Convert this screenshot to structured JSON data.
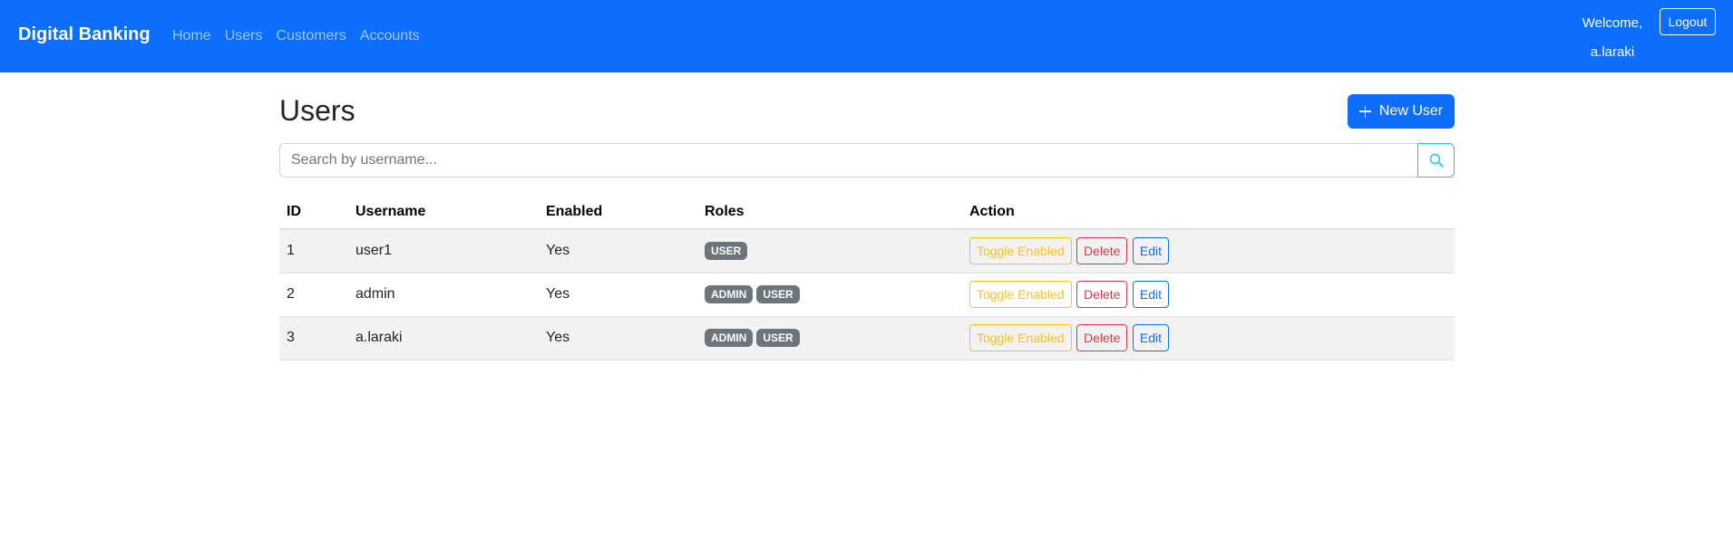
{
  "navbar": {
    "brand": "Digital Banking",
    "links": [
      "Home",
      "Users",
      "Customers",
      "Accounts"
    ],
    "welcome_line1": "Welcome,",
    "welcome_line2": "a.laraki",
    "logout_label": "Logout",
    "background_color": "#0d6efd"
  },
  "page": {
    "title": "Users",
    "new_user_label": "New User",
    "new_user_icon": "plus-icon"
  },
  "search": {
    "placeholder": "Search by username...",
    "value": "",
    "icon": "search-icon"
  },
  "table": {
    "headers": [
      "ID",
      "Username",
      "Enabled",
      "Roles",
      "Action"
    ],
    "rows": [
      {
        "id": "1",
        "username": "user1",
        "enabled": "Yes",
        "roles": [
          "USER"
        ]
      },
      {
        "id": "2",
        "username": "admin",
        "enabled": "Yes",
        "roles": [
          "ADMIN",
          "USER"
        ]
      },
      {
        "id": "3",
        "username": "a.laraki",
        "enabled": "Yes",
        "roles": [
          "ADMIN",
          "USER"
        ]
      }
    ],
    "actions": {
      "toggle_label": "Toggle Enabled",
      "delete_label": "Delete",
      "edit_label": "Edit"
    }
  },
  "colors": {
    "primary": "#0d6efd",
    "success": "#198754",
    "warning": "#ffc107",
    "danger": "#dc3545",
    "info": "#0dcaf0",
    "badge": "#6c757d"
  }
}
